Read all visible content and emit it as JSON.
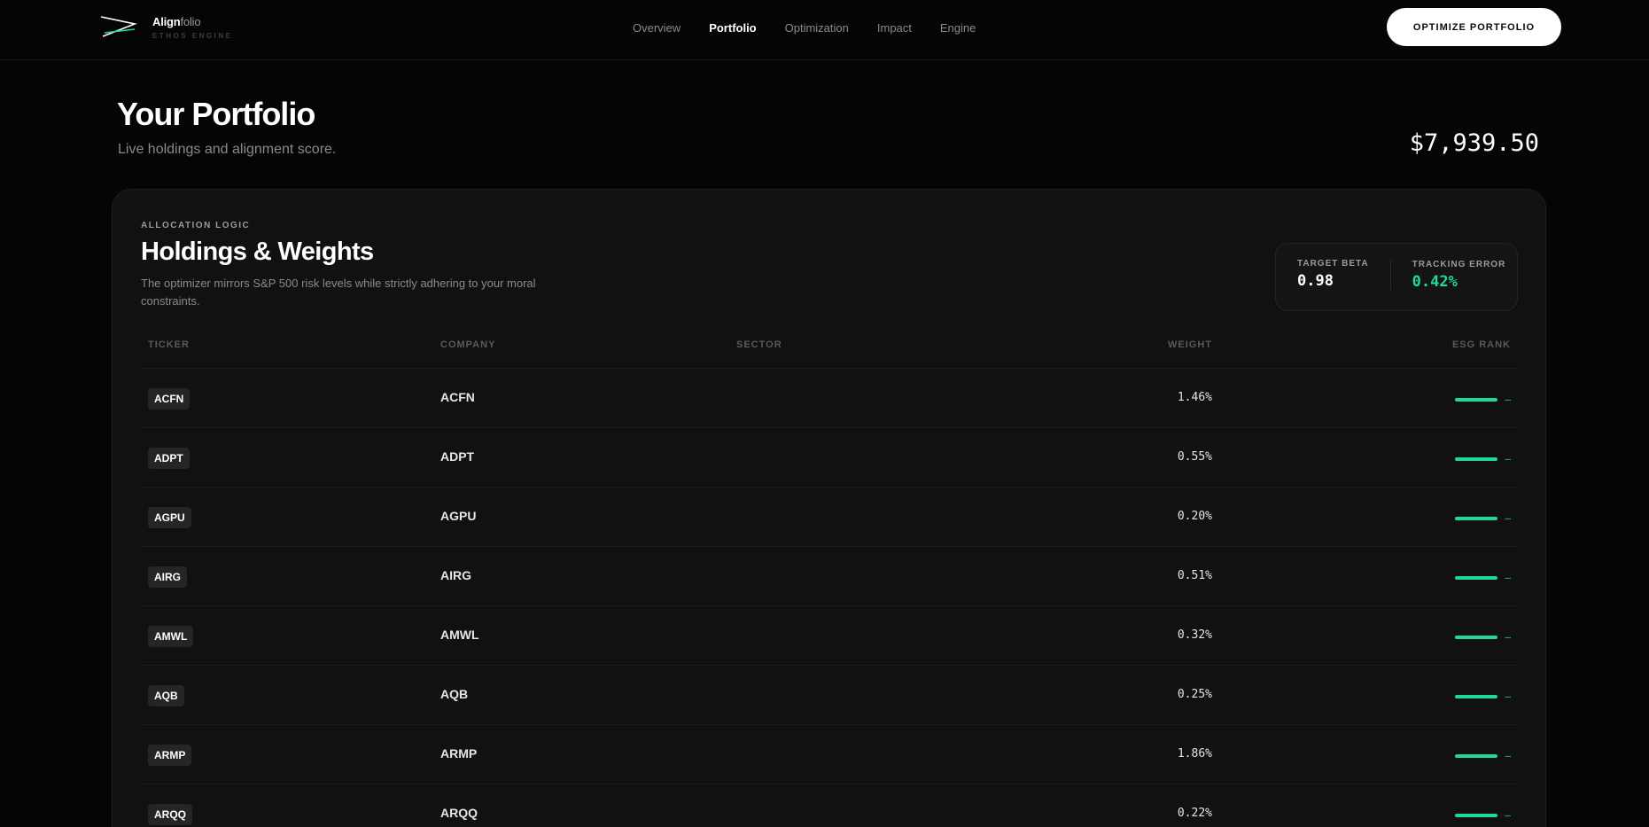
{
  "brand": {
    "name_bold": "Align",
    "name_light": "folio",
    "sub": "ETHOS ENGINE"
  },
  "nav": {
    "links": [
      {
        "label": "Overview",
        "active": false
      },
      {
        "label": "Portfolio",
        "active": true
      },
      {
        "label": "Optimization",
        "active": false
      },
      {
        "label": "Impact",
        "active": false
      },
      {
        "label": "Engine",
        "active": false
      }
    ],
    "cta_label": "OPTIMIZE PORTFOLIO"
  },
  "header": {
    "title": "Your Portfolio",
    "subtitle": "Live holdings and alignment score.",
    "total_value": "$7,939.50"
  },
  "card": {
    "eyebrow": "ALLOCATION LOGIC",
    "title": "Holdings & Weights",
    "description": "The optimizer mirrors S&P 500 risk levels while strictly adhering to your moral constraints.",
    "metrics": [
      {
        "label": "TARGET BETA",
        "value": "0.98",
        "accent": false
      },
      {
        "label": "TRACKING ERROR",
        "value": "0.42%",
        "accent": true
      }
    ],
    "columns": [
      "TICKER",
      "COMPANY",
      "SECTOR",
      "WEIGHT",
      "ESG RANK"
    ],
    "rows": [
      {
        "ticker": "ACFN",
        "company": "ACFN",
        "sector": "",
        "weight": "1.46%",
        "esg": "–"
      },
      {
        "ticker": "ADPT",
        "company": "ADPT",
        "sector": "",
        "weight": "0.55%",
        "esg": "–"
      },
      {
        "ticker": "AGPU",
        "company": "AGPU",
        "sector": "",
        "weight": "0.20%",
        "esg": "–"
      },
      {
        "ticker": "AIRG",
        "company": "AIRG",
        "sector": "",
        "weight": "0.51%",
        "esg": "–"
      },
      {
        "ticker": "AMWL",
        "company": "AMWL",
        "sector": "",
        "weight": "0.32%",
        "esg": "–"
      },
      {
        "ticker": "AQB",
        "company": "AQB",
        "sector": "",
        "weight": "0.25%",
        "esg": "–"
      },
      {
        "ticker": "ARMP",
        "company": "ARMP",
        "sector": "",
        "weight": "1.86%",
        "esg": "–"
      },
      {
        "ticker": "ARQQ",
        "company": "ARQQ",
        "sector": "",
        "weight": "0.22%",
        "esg": "–"
      }
    ]
  },
  "colors": {
    "accent": "#1ed99a",
    "background": "#050505",
    "card": "#111111"
  },
  "icons": {
    "logo": "align-chevron-logo-icon"
  }
}
